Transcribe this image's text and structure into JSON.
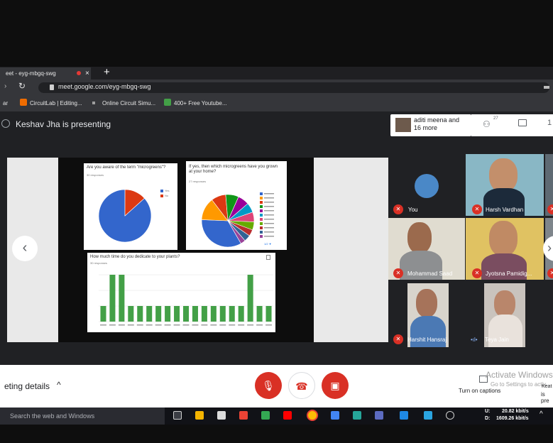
{
  "browser": {
    "tab_title": "eet - eyg-mbgq-swg",
    "tab_close": "×",
    "new_tab": "+",
    "url": "meet.google.com/eyg-mbgq-swg",
    "bookmarks": [
      "CircuitLab | Editing...",
      "Online Circuit Simu...",
      "400+ Free Youtube..."
    ]
  },
  "meet": {
    "presenting_label": "Keshav Jha is presenting",
    "people_chip": "aditi meena and 16 more",
    "people_count": "27",
    "slide": {
      "q1_title": "Are you aware of the term \"microgreens\"?",
      "q1_responses": "30 responses",
      "q1_legend": [
        "Yes",
        "No"
      ],
      "q2_title": "If yes, then which microgreens have you grown at your home?",
      "q2_responses": "27 responses",
      "q2_more": "1/2 ▼",
      "q3_title": "How much time do you dedicate to your plants?",
      "q3_responses": "30 responses"
    },
    "participants": [
      {
        "name": "You"
      },
      {
        "name": "Harsh Vardhan"
      },
      {
        "name": "Mohammad Saad"
      },
      {
        "name": "Jyotsna Pamidig..."
      },
      {
        "name": "Harshit Hansraj"
      },
      {
        "name": "Teya Jain"
      }
    ],
    "meeting_details": "eting details",
    "turn_on_captions": "Turn on captions",
    "activate_windows": "Activate Windows",
    "activate_sub": "Go to Settings to activ",
    "side_text1": "Keat",
    "side_text2": "is pre"
  },
  "taskbar": {
    "search_placeholder": "Search the web and Windows",
    "net_up_label": "U:",
    "net_up": "20.82 kbit/s",
    "net_down_label": "D:",
    "net_down": "1609.26 kbit/s"
  },
  "chart_data": [
    {
      "type": "pie",
      "title": "Are you aware of the term \"microgreens\"?",
      "categories": [
        "Yes",
        "No"
      ],
      "values": [
        86.7,
        13.3
      ],
      "colors": [
        "#3366cc",
        "#dc3912"
      ]
    },
    {
      "type": "pie",
      "title": "If yes, then which microgreens have you grown at your home?",
      "values": [
        34,
        14,
        9,
        8,
        7,
        6,
        6,
        5,
        4,
        4,
        3
      ],
      "colors": [
        "#3366cc",
        "#ff9900",
        "#dc3912",
        "#109618",
        "#990099",
        "#0099c6",
        "#dd4477",
        "#66aa00",
        "#b82e2e",
        "#316395",
        "#994499"
      ]
    },
    {
      "type": "bar",
      "title": "How much time do you dedicate to your plants?",
      "values": [
        1,
        3,
        3,
        1,
        1,
        1,
        1,
        1,
        1,
        1,
        1,
        1,
        1,
        1,
        1,
        1,
        3,
        1,
        1
      ],
      "ylim": [
        0,
        3
      ],
      "color": "#43a047"
    }
  ]
}
